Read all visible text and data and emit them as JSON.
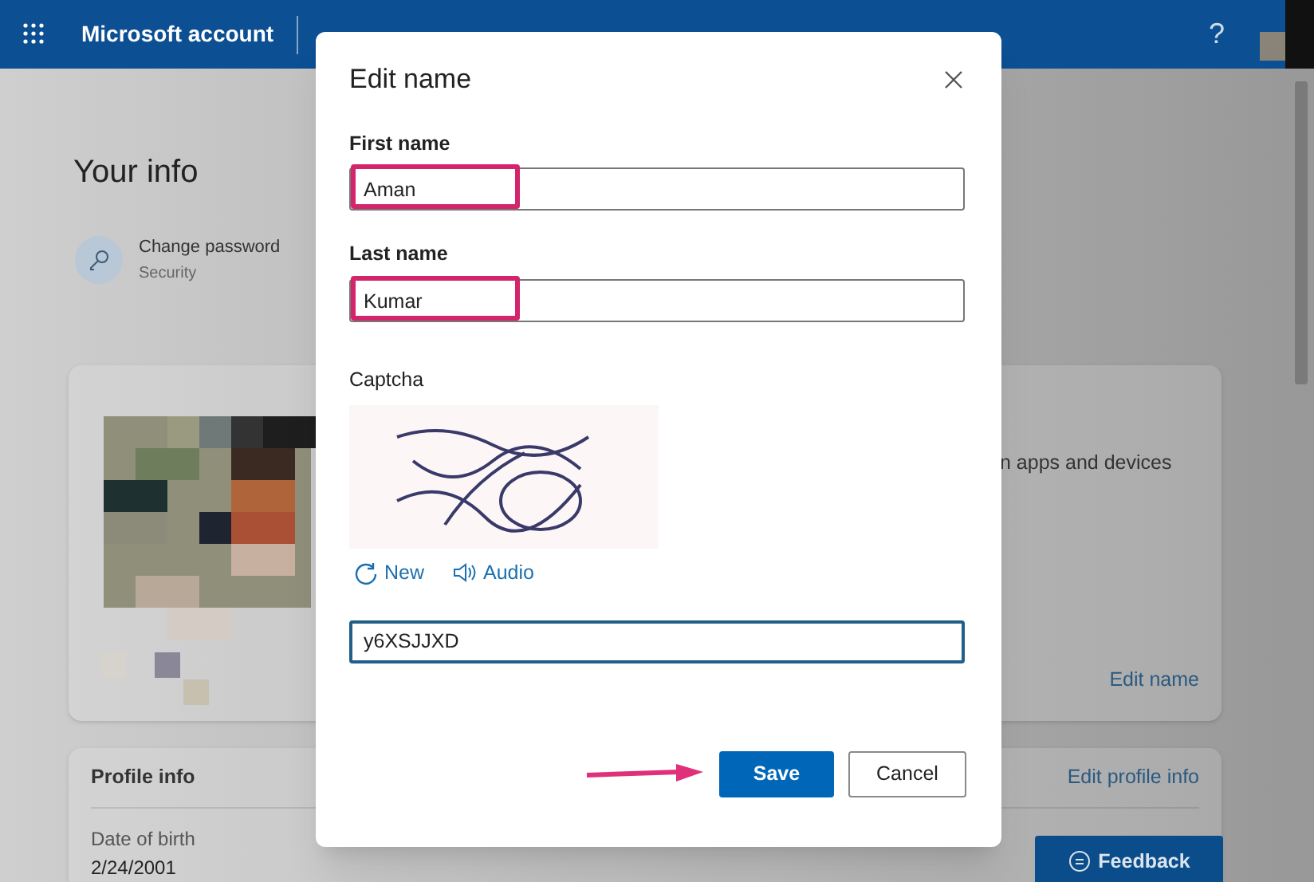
{
  "header": {
    "brand": "Microsoft account",
    "help": "?"
  },
  "page": {
    "title": "Your info",
    "shortcut": {
      "label": "Change password",
      "sub": "Security"
    },
    "name_card": {
      "text": "n apps and devices",
      "link": "Edit name"
    },
    "profile_card": {
      "title": "Profile info",
      "link": "Edit profile info",
      "field_label": "Date of birth",
      "field_value": "2/24/2001"
    },
    "feedback": "Feedback"
  },
  "dialog": {
    "title": "Edit name",
    "fields": [
      {
        "label": "First name",
        "value": "Aman",
        "highlighted": true
      },
      {
        "label": "Last name",
        "value": "Kumar",
        "highlighted": true
      }
    ],
    "captcha": {
      "label": "Captcha",
      "new": "New",
      "audio": "Audio",
      "value": "y6XSJJXD"
    },
    "buttons": [
      {
        "label": "Save",
        "kind": "primary"
      },
      {
        "label": "Cancel",
        "kind": "secondary"
      }
    ]
  }
}
